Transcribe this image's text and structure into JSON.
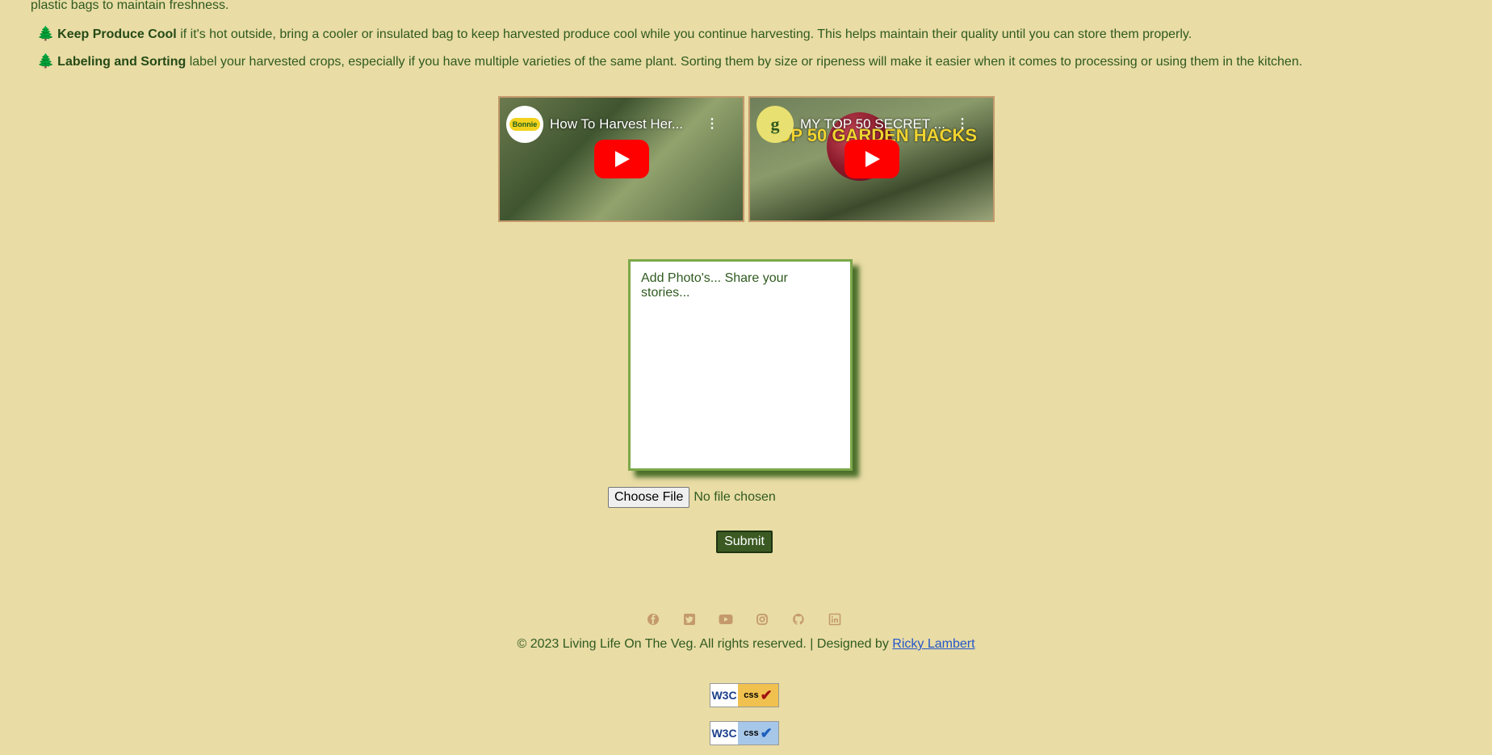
{
  "tips": {
    "intro_tail": "plastic bags to maintain freshness.",
    "items": [
      {
        "icon": "tree-icon",
        "glyph": "🌲",
        "title": "Keep Produce Cool",
        "text": " if it's hot outside, bring a cooler or insulated bag to keep harvested produce cool while you continue harvesting. This helps maintain their quality until you can store them properly."
      },
      {
        "icon": "tree-icon",
        "glyph": "🌲",
        "title": "Labeling and Sorting",
        "text": " label your harvested crops, especially if you have multiple varieties of the same plant. Sorting them by size or ripeness will make it easier when it comes to processing or using them in the kitchen."
      }
    ]
  },
  "videos": [
    {
      "title": "How To Harvest Her...",
      "channel_logo_text": "Bonnie"
    },
    {
      "title": "MY TOP 50 SECRET ...",
      "channel_logo_text": "g",
      "thumb_text": "TOP 50 GARDEN HACKS"
    }
  ],
  "story_form": {
    "placeholder": "Add Photo's... Share your stories...",
    "file_button": "Choose File",
    "file_status": "No file chosen",
    "submit": "Submit"
  },
  "footer": {
    "social_icons": [
      "facebook-icon",
      "twitter-icon",
      "youtube-icon",
      "instagram-icon",
      "github-icon",
      "linkedin-icon"
    ],
    "copyright": "© 2023 Living Life On The Veg. All rights reserved. | Designed by ",
    "designer": "Ricky Lambert",
    "badges": [
      {
        "w3c": "W3C",
        "label": "css"
      },
      {
        "w3c": "W3C",
        "label": "css"
      }
    ]
  },
  "colors": {
    "background": "#e9dca5",
    "text": "#2f5a1f",
    "submit_bg": "#3b5a23",
    "link": "#2456c9",
    "icon": "#c49a6c"
  }
}
